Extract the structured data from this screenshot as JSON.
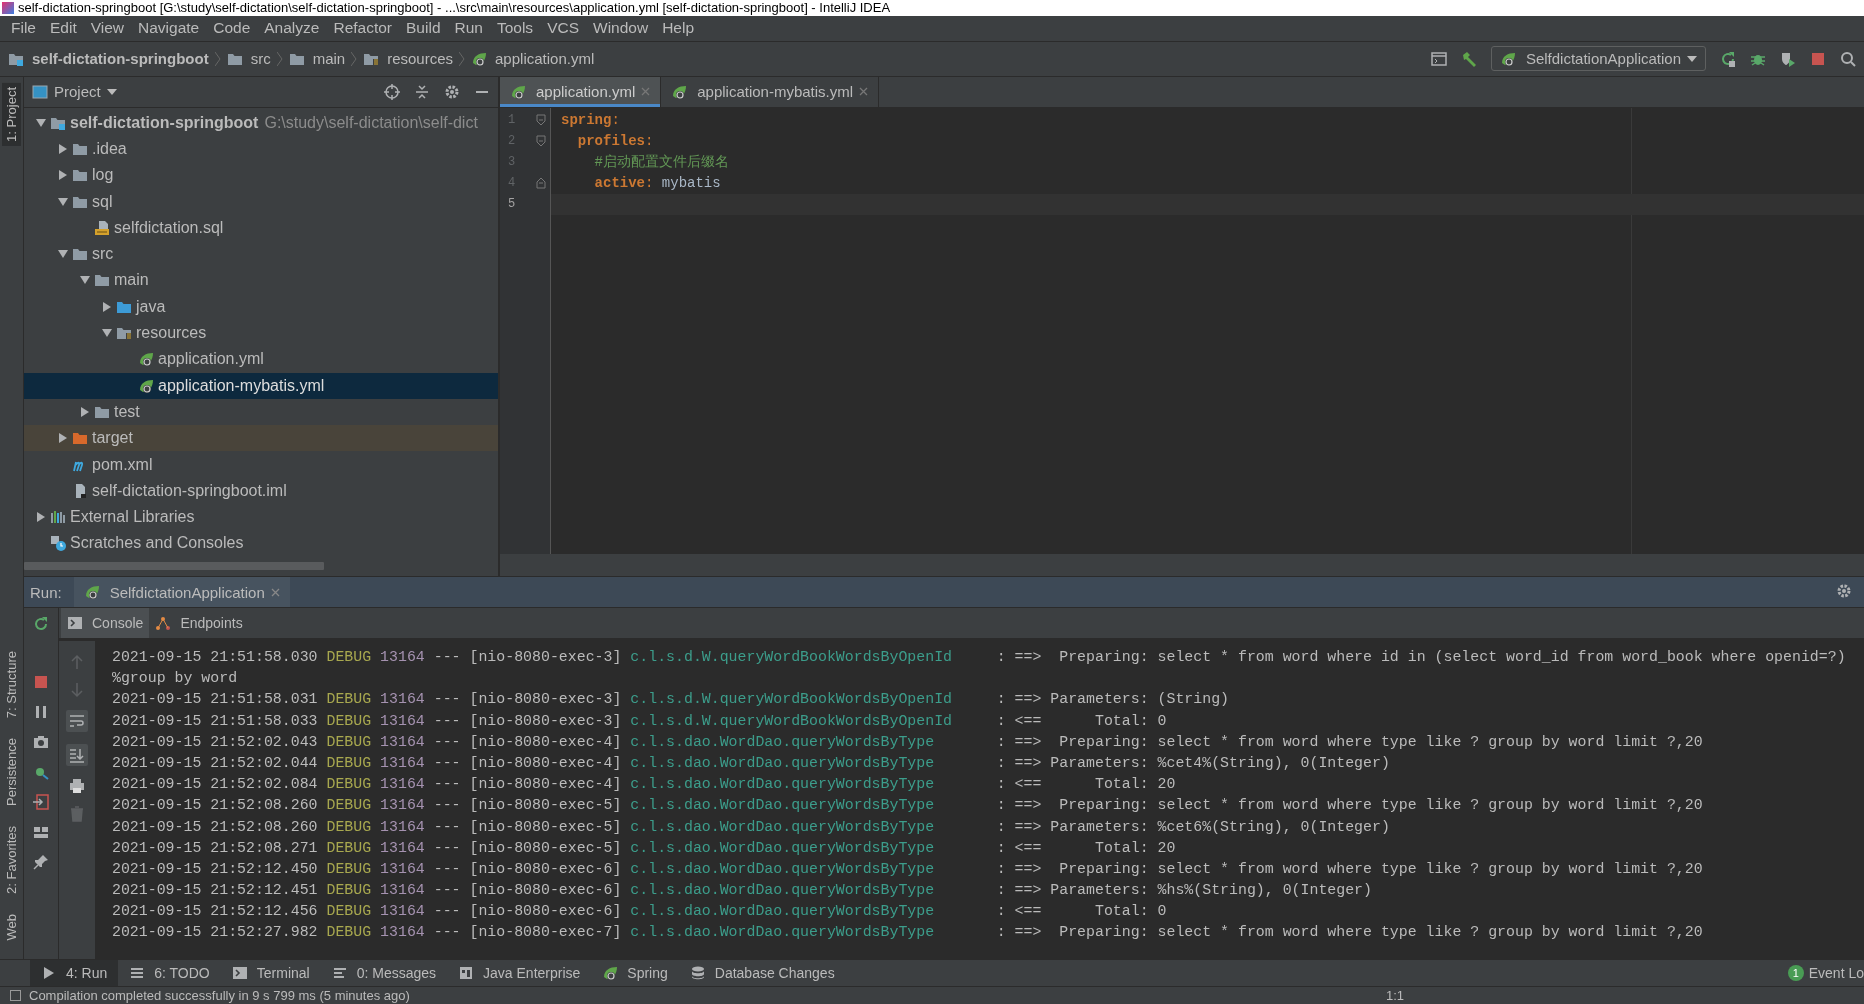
{
  "title_bar": {
    "title": "self-dictation-springboot [G:\\study\\self-dictation\\self-dictation-springboot] - ...\\src\\main\\resources\\application.yml [self-dictation-springboot] - IntelliJ IDEA"
  },
  "menu": [
    "File",
    "Edit",
    "View",
    "Navigate",
    "Code",
    "Analyze",
    "Refactor",
    "Build",
    "Run",
    "Tools",
    "VCS",
    "Window",
    "Help"
  ],
  "breadcrumbs": [
    {
      "label": "self-dictation-springboot",
      "kind": "project"
    },
    {
      "label": "src",
      "kind": "folder"
    },
    {
      "label": "main",
      "kind": "folder"
    },
    {
      "label": "resources",
      "kind": "resources"
    },
    {
      "label": "application.yml",
      "kind": "spring"
    }
  ],
  "run_config": {
    "label": "SelfdictationApplication"
  },
  "side_tabs": [
    {
      "label": "1: Project",
      "selected": true
    },
    {
      "label": "7: Structure",
      "selected": false
    },
    {
      "label": "Persistence",
      "selected": false
    },
    {
      "label": "2: Favorites",
      "selected": false
    },
    {
      "label": "Web",
      "selected": false
    }
  ],
  "project_panel": {
    "title": "Project",
    "tree": [
      {
        "label": "self-dictation-springboot",
        "path": "G:\\study\\self-dictation\\self-dict",
        "kind": "project",
        "expanded": true,
        "selected": false,
        "children": [
          {
            "label": ".idea",
            "kind": "folder",
            "expanded": false,
            "selected": false
          },
          {
            "label": "log",
            "kind": "folder",
            "expanded": false,
            "selected": false
          },
          {
            "label": "sql",
            "kind": "folder",
            "expanded": true,
            "selected": false,
            "children": [
              {
                "label": "selfdictation.sql",
                "kind": "sql",
                "selected": false
              }
            ]
          },
          {
            "label": "src",
            "kind": "folder",
            "expanded": true,
            "selected": false,
            "children": [
              {
                "label": "main",
                "kind": "folder",
                "expanded": true,
                "selected": false,
                "children": [
                  {
                    "label": "java",
                    "kind": "source",
                    "expanded": false,
                    "selected": false
                  },
                  {
                    "label": "resources",
                    "kind": "resources",
                    "expanded": true,
                    "selected": false,
                    "children": [
                      {
                        "label": "application.yml",
                        "kind": "spring",
                        "selected": false
                      },
                      {
                        "label": "application-mybatis.yml",
                        "kind": "spring",
                        "selected": true
                      }
                    ]
                  }
                ]
              },
              {
                "label": "test",
                "kind": "folder",
                "expanded": false,
                "selected": false
              }
            ]
          },
          {
            "label": "target",
            "kind": "excluded",
            "expanded": false,
            "selected": false
          },
          {
            "label": "pom.xml",
            "kind": "maven",
            "selected": false
          },
          {
            "label": "self-dictation-springboot.iml",
            "kind": "iml",
            "selected": false
          }
        ]
      },
      {
        "label": "External Libraries",
        "kind": "libraries",
        "expanded": false,
        "selected": false
      },
      {
        "label": "Scratches and Consoles",
        "kind": "scratches",
        "selected": false
      }
    ]
  },
  "editor": {
    "tabs": [
      {
        "label": "application.yml",
        "selected": true
      },
      {
        "label": "application-mybatis.yml",
        "selected": false
      }
    ],
    "lines": [
      {
        "number": "1",
        "kind": "foldstart",
        "current": false,
        "tokens": [
          {
            "kind": "key",
            "text": "spring"
          },
          {
            "kind": "punct",
            "text": ":"
          }
        ]
      },
      {
        "number": "2",
        "kind": "foldstart",
        "current": false,
        "tokens": [
          {
            "kind": "key",
            "text": "  profiles"
          },
          {
            "kind": "punct",
            "text": ":"
          }
        ]
      },
      {
        "number": "3",
        "kind": "plain",
        "current": false,
        "tokens": [
          {
            "kind": "comment",
            "text": "    #启动配置文件后缀名"
          }
        ]
      },
      {
        "number": "4",
        "kind": "foldend",
        "current": false,
        "tokens": [
          {
            "kind": "key",
            "text": "    active"
          },
          {
            "kind": "punct",
            "text": ": "
          },
          {
            "kind": "value",
            "text": "mybatis"
          }
        ]
      },
      {
        "number": "5",
        "kind": "plain",
        "current": true
      }
    ]
  },
  "run_panel": {
    "label": "Run:",
    "tab": "SelfdictationApplication",
    "subtabs": [
      {
        "label": "Console",
        "kind": "console",
        "selected": true
      },
      {
        "label": "Endpoints",
        "kind": "endpoints",
        "selected": false
      }
    ],
    "log": [
      {
        "kind": "entry",
        "time": "2021-09-15 21:51:58.030",
        "level": "DEBUG",
        "pid": "13164",
        "sep": "---",
        "thread": "[nio-8080-exec-3]",
        "logger": "c.l.s.d.W.queryWordBookWordsByOpenId",
        "message": ": ==>  Preparing: select * from word where id in (select word_id from word_book where openid=?)"
      },
      {
        "kind": "continuation",
        "text": "%group by word"
      },
      {
        "kind": "entry",
        "time": "2021-09-15 21:51:58.031",
        "level": "DEBUG",
        "pid": "13164",
        "sep": "---",
        "thread": "[nio-8080-exec-3]",
        "logger": "c.l.s.d.W.queryWordBookWordsByOpenId",
        "message": ": ==> Parameters: (String)"
      },
      {
        "kind": "entry",
        "time": "2021-09-15 21:51:58.033",
        "level": "DEBUG",
        "pid": "13164",
        "sep": "---",
        "thread": "[nio-8080-exec-3]",
        "logger": "c.l.s.d.W.queryWordBookWordsByOpenId",
        "message": ": <==      Total: 0"
      },
      {
        "kind": "entry",
        "time": "2021-09-15 21:52:02.043",
        "level": "DEBUG",
        "pid": "13164",
        "sep": "---",
        "thread": "[nio-8080-exec-4]",
        "logger": "c.l.s.dao.WordDao.queryWordsByType",
        "message": ": ==>  Preparing: select * from word where type like ? group by word limit ?,20"
      },
      {
        "kind": "entry",
        "time": "2021-09-15 21:52:02.044",
        "level": "DEBUG",
        "pid": "13164",
        "sep": "---",
        "thread": "[nio-8080-exec-4]",
        "logger": "c.l.s.dao.WordDao.queryWordsByType",
        "message": ": ==> Parameters: %cet4%(String), 0(Integer)"
      },
      {
        "kind": "entry",
        "time": "2021-09-15 21:52:02.084",
        "level": "DEBUG",
        "pid": "13164",
        "sep": "---",
        "thread": "[nio-8080-exec-4]",
        "logger": "c.l.s.dao.WordDao.queryWordsByType",
        "message": ": <==      Total: 20"
      },
      {
        "kind": "entry",
        "time": "2021-09-15 21:52:08.260",
        "level": "DEBUG",
        "pid": "13164",
        "sep": "---",
        "thread": "[nio-8080-exec-5]",
        "logger": "c.l.s.dao.WordDao.queryWordsByType",
        "message": ": ==>  Preparing: select * from word where type like ? group by word limit ?,20"
      },
      {
        "kind": "entry",
        "time": "2021-09-15 21:52:08.260",
        "level": "DEBUG",
        "pid": "13164",
        "sep": "---",
        "thread": "[nio-8080-exec-5]",
        "logger": "c.l.s.dao.WordDao.queryWordsByType",
        "message": ": ==> Parameters: %cet6%(String), 0(Integer)"
      },
      {
        "kind": "entry",
        "time": "2021-09-15 21:52:08.271",
        "level": "DEBUG",
        "pid": "13164",
        "sep": "---",
        "thread": "[nio-8080-exec-5]",
        "logger": "c.l.s.dao.WordDao.queryWordsByType",
        "message": ": <==      Total: 20"
      },
      {
        "kind": "entry",
        "time": "2021-09-15 21:52:12.450",
        "level": "DEBUG",
        "pid": "13164",
        "sep": "---",
        "thread": "[nio-8080-exec-6]",
        "logger": "c.l.s.dao.WordDao.queryWordsByType",
        "message": ": ==>  Preparing: select * from word where type like ? group by word limit ?,20"
      },
      {
        "kind": "entry",
        "time": "2021-09-15 21:52:12.451",
        "level": "DEBUG",
        "pid": "13164",
        "sep": "---",
        "thread": "[nio-8080-exec-6]",
        "logger": "c.l.s.dao.WordDao.queryWordsByType",
        "message": ": ==> Parameters: %hs%(String), 0(Integer)"
      },
      {
        "kind": "entry",
        "time": "2021-09-15 21:52:12.456",
        "level": "DEBUG",
        "pid": "13164",
        "sep": "---",
        "thread": "[nio-8080-exec-6]",
        "logger": "c.l.s.dao.WordDao.queryWordsByType",
        "message": ": <==      Total: 0"
      },
      {
        "kind": "entry",
        "time": "2021-09-15 21:52:27.982",
        "level": "DEBUG",
        "pid": "13164",
        "sep": "---",
        "thread": "[nio-8080-exec-7]",
        "logger": "c.l.s.dao.WordDao.queryWordsByType",
        "message": ": ==>  Preparing: select * from word where type like ? group by word limit ?,20"
      }
    ]
  },
  "tool_tabs": [
    {
      "label": "4: Run",
      "kind": "run",
      "selected": true
    },
    {
      "label": "6: TODO",
      "kind": "todo",
      "selected": false
    },
    {
      "label": "Terminal",
      "kind": "terminal",
      "selected": false
    },
    {
      "label": "0: Messages",
      "kind": "messages",
      "selected": false
    },
    {
      "label": "Java Enterprise",
      "kind": "enterprise",
      "selected": false
    },
    {
      "label": "Spring",
      "kind": "spring",
      "selected": false
    },
    {
      "label": "Database Changes",
      "kind": "database",
      "selected": false
    }
  ],
  "event_log": {
    "count": "1",
    "label": "Event Lo"
  },
  "status_bar": {
    "message": "Compilation completed successfully in 9 s 799 ms (5 minutes ago)",
    "position": "1:1"
  }
}
